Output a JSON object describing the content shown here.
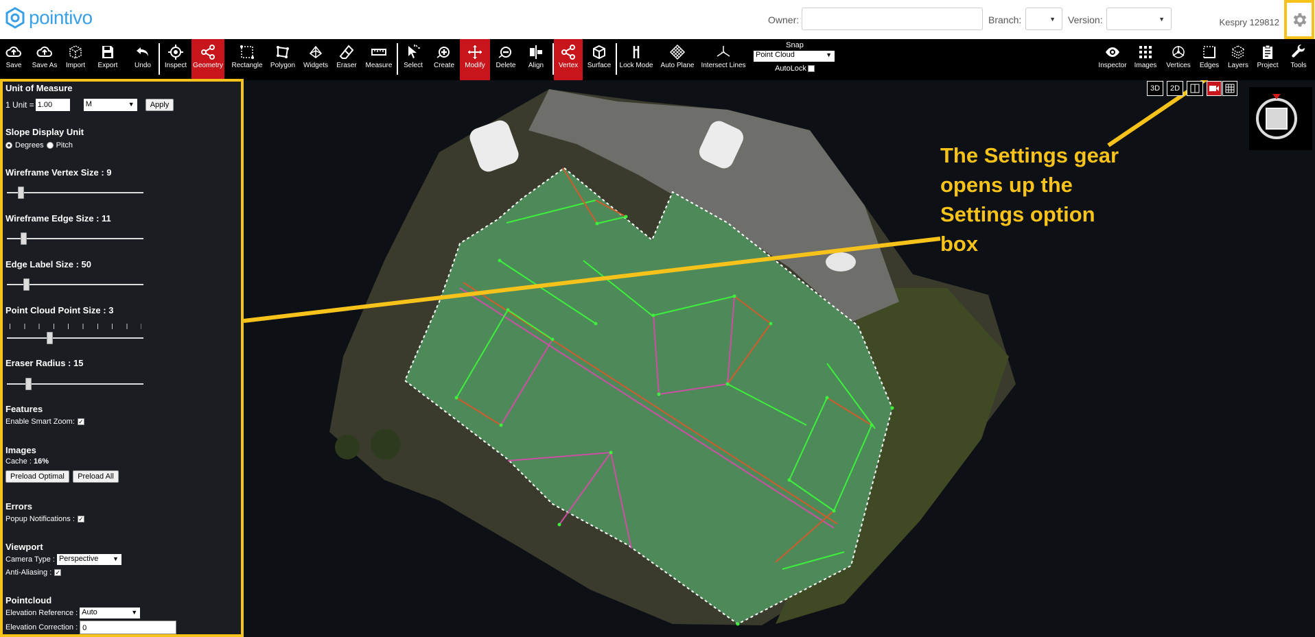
{
  "app": {
    "logo_text": "pointivo",
    "user": "Kespry 129812"
  },
  "topbar": {
    "owner_label": "Owner:",
    "owner_value": "",
    "branch_label": "Branch:",
    "version_label": "Version:"
  },
  "toolbar": {
    "left_tools": [
      {
        "id": "save",
        "label": "Save",
        "icon": "cloud-upload-icon",
        "active": false
      },
      {
        "id": "save-as",
        "label": "Save As",
        "icon": "cloud-upload-icon",
        "active": false
      },
      {
        "id": "import",
        "label": "Import",
        "icon": "cube-icon",
        "active": false
      },
      {
        "id": "export",
        "label": "Export",
        "icon": "floppy-icon",
        "active": false
      },
      {
        "id": "undo",
        "label": "Undo",
        "icon": "undo-icon",
        "active": false
      },
      {
        "id": "inspect",
        "label": "Inspect",
        "icon": "target-icon",
        "active": false
      },
      {
        "id": "geometry",
        "label": "Geometry",
        "icon": "share-icon",
        "active": true
      },
      {
        "id": "rectangle",
        "label": "Rectangle",
        "icon": "rectangle-icon",
        "active": false
      },
      {
        "id": "polygon",
        "label": "Polygon",
        "icon": "polygon-icon",
        "active": false
      },
      {
        "id": "widgets",
        "label": "Widgets",
        "icon": "widgets-icon",
        "active": false
      },
      {
        "id": "eraser",
        "label": "Eraser",
        "icon": "eraser-icon",
        "active": false
      },
      {
        "id": "measure",
        "label": "Measure",
        "icon": "ruler-icon",
        "active": false
      },
      {
        "id": "select",
        "label": "Select",
        "icon": "cursor-icon",
        "active": false
      },
      {
        "id": "create",
        "label": "Create",
        "icon": "plus-circle-icon",
        "active": false
      },
      {
        "id": "modify",
        "label": "Modify",
        "icon": "move-icon",
        "active": true
      },
      {
        "id": "delete",
        "label": "Delete",
        "icon": "minus-circle-icon",
        "active": false
      },
      {
        "id": "align",
        "label": "Align",
        "icon": "align-icon",
        "active": false
      },
      {
        "id": "vertex",
        "label": "Vertex",
        "icon": "share-icon",
        "active": true
      },
      {
        "id": "surface",
        "label": "Surface",
        "icon": "box-icon",
        "active": false
      },
      {
        "id": "lock-mode",
        "label": "Lock Mode",
        "icon": "lock-mode-icon",
        "active": false
      },
      {
        "id": "auto-plane",
        "label": "Auto Plane",
        "icon": "grid-diamond-icon",
        "active": false
      },
      {
        "id": "intersect-lines",
        "label": "Intersect Lines",
        "icon": "intersect-icon",
        "active": false
      }
    ],
    "right_tools": [
      {
        "id": "inspector",
        "label": "Inspector",
        "icon": "eye-icon"
      },
      {
        "id": "images",
        "label": "Images",
        "icon": "grid-dots-icon"
      },
      {
        "id": "vertices",
        "label": "Vertices",
        "icon": "vertices-icon"
      },
      {
        "id": "edges",
        "label": "Edges",
        "icon": "edges-icon"
      },
      {
        "id": "layers",
        "label": "Layers",
        "icon": "layers-icon"
      },
      {
        "id": "project",
        "label": "Project",
        "icon": "clipboard-icon"
      },
      {
        "id": "tools",
        "label": "Tools",
        "icon": "wrench-icon"
      }
    ],
    "snap_label": "Snap",
    "snap_value": "Point Cloud",
    "autolock_label": "AutoLock"
  },
  "view_buttons": [
    "3D",
    "2D"
  ],
  "settings": {
    "unit_of_measure": {
      "title": "Unit of Measure",
      "unit_label": "1 Unit =",
      "unit_value": "1.00",
      "unit_select": "M",
      "apply": "Apply"
    },
    "slope": {
      "title": "Slope Display Unit",
      "degrees": "Degrees",
      "pitch": "Pitch"
    },
    "vertex_size": {
      "title": "Wireframe Vertex Size : 9",
      "value": 9,
      "max": 100
    },
    "edge_size": {
      "title": "Wireframe Edge Size : 11",
      "value": 11,
      "max": 100
    },
    "edge_label": {
      "title": "Edge Label Size : 50",
      "value": 50,
      "max": 300
    },
    "point_size": {
      "title": "Point Cloud Point Size : 3",
      "value": 3,
      "max": 10
    },
    "eraser": {
      "title": "Eraser Radius : 15",
      "value": 15,
      "max": 100
    },
    "features": {
      "title": "Features",
      "smart_zoom": "Enable Smart Zoom:"
    },
    "images": {
      "title": "Images",
      "cache_label": "Cache :",
      "cache_value": "16%",
      "preload_optimal": "Preload Optimal",
      "preload_all": "Preload All"
    },
    "errors": {
      "title": "Errors",
      "popup": "Popup Notifications :"
    },
    "viewport": {
      "title": "Viewport",
      "camera_label": "Camera Type :",
      "camera_value": "Perspective",
      "aa_label": "Anti-Aliasing :"
    },
    "pointcloud": {
      "title": "Pointcloud",
      "elev_ref_label": "Elevation Reference :",
      "elev_ref_value": "Auto",
      "elev_corr_label": "Elevation Correction :",
      "elev_corr_value": "0"
    }
  },
  "callout": {
    "line1": "The Settings gear",
    "line2": "opens up the",
    "line3": "Settings option",
    "line4": "box",
    "color": "#f7c31b"
  }
}
